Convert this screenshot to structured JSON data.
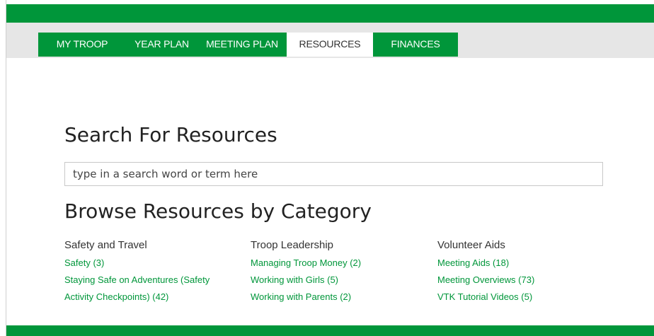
{
  "nav": {
    "tabs": [
      {
        "label": "MY TROOP"
      },
      {
        "label": "YEAR PLAN"
      },
      {
        "label": "MEETING PLAN"
      },
      {
        "label": "RESOURCES"
      },
      {
        "label": "FINANCES"
      }
    ],
    "active_tab": "RESOURCES"
  },
  "search": {
    "heading": "Search For Resources",
    "placeholder": "type in a search word or term here"
  },
  "browse": {
    "heading": "Browse Resources by Category",
    "columns": [
      {
        "title": "Safety and Travel",
        "links": [
          "Safety (3)",
          "Staying Safe on Adventures (Safety",
          "Activity Checkpoints) (42)"
        ]
      },
      {
        "title": "Troop Leadership",
        "links": [
          "Managing Troop Money (2)",
          "Working with Girls (5)",
          "Working with Parents (2)"
        ]
      },
      {
        "title": "Volunteer Aids",
        "links": [
          "Meeting Aids (18)",
          "Meeting Overviews (73)",
          "VTK Tutorial Videos (5)"
        ]
      }
    ]
  },
  "colors": {
    "brand_green": "#00963a",
    "nav_background": "#e6e6e6",
    "text_dark": "#222222"
  }
}
